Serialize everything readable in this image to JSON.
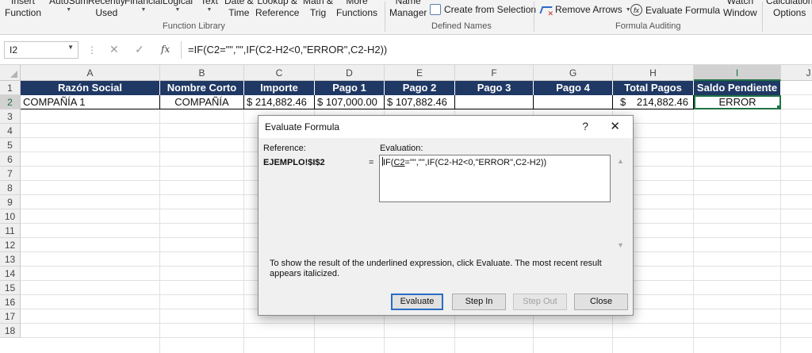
{
  "ribbon": {
    "function_library": {
      "insert_function": "Insert\nFunction",
      "autosum": "AutoSum",
      "recently_used": "Recently\nUsed",
      "financial": "Financial",
      "logical": "Logical",
      "text": "Text",
      "date_time": "Date &\nTime",
      "lookup_reference": "Lookup &\nReference",
      "math_trig": "Math &\nTrig",
      "more_functions": "More\nFunctions",
      "group_label": "Function Library"
    },
    "defined_names": {
      "name_manager": "Name\nManager",
      "create_from_selection": "Create from Selection",
      "group_label": "Defined Names"
    },
    "formula_auditing": {
      "remove_arrows": "Remove Arrows",
      "evaluate_formula": "Evaluate Formula",
      "watch_window": "Watch\nWindow",
      "group_label": "Formula Auditing"
    },
    "calculation": {
      "calculation_options": "Calculation\nOptions"
    }
  },
  "formula_bar": {
    "name_box": "I2",
    "fx_label": "fx",
    "formula": "=IF(C2=\"\",\"\",IF(C2-H2<0,\"ERROR\",C2-H2))"
  },
  "sheet": {
    "columns": [
      {
        "label": "A",
        "w": 176
      },
      {
        "label": "B",
        "w": 106
      },
      {
        "label": "C",
        "w": 89
      },
      {
        "label": "D",
        "w": 88
      },
      {
        "label": "E",
        "w": 89
      },
      {
        "label": "F",
        "w": 99
      },
      {
        "label": "G",
        "w": 100
      },
      {
        "label": "H",
        "w": 102
      },
      {
        "label": "I",
        "w": 110
      },
      {
        "label": "J",
        "w": 70
      }
    ],
    "selected_column": "I",
    "rows": [
      "1",
      "2",
      "3",
      "4",
      "5",
      "6",
      "7",
      "8",
      "9",
      "10",
      "11",
      "12",
      "13",
      "14",
      "15",
      "16",
      "17",
      "18"
    ],
    "selected_row": "2",
    "header_row": [
      "Razón Social",
      "Nombre Corto",
      "Importe",
      "Pago 1",
      "Pago 2",
      "Pago 3",
      "Pago 4",
      "Total Pagos",
      "Saldo Pendiente"
    ],
    "data_row": {
      "a": "COMPAÑÍA 1",
      "b": "COMPAÑÍA",
      "c": "$ 214,882.46",
      "d": "$ 107,000.00",
      "e": "$ 107,882.46",
      "f": "",
      "g": "",
      "h_currency": "$",
      "h_value": "214,882.46",
      "i": "ERROR"
    },
    "header_color": "#1f3864",
    "selection_color": "#217346"
  },
  "dialog": {
    "title": "Evaluate Formula",
    "help": "?",
    "close": "✕",
    "reference_label": "Reference:",
    "evaluation_label": "Evaluation:",
    "reference_value": "EJEMPLO!$I$2",
    "equals": "=",
    "evaluation_prefix": "IF(",
    "evaluation_underlined": "C2",
    "evaluation_suffix": "=\"\",\"\",IF(C2-H2<0,\"ERROR\",C2-H2))",
    "help_text": "To show the result of the underlined expression, click Evaluate.  The most recent result appears italicized.",
    "buttons": {
      "evaluate": "Evaluate",
      "step_in": "Step In",
      "step_out": "Step Out",
      "close": "Close"
    }
  }
}
